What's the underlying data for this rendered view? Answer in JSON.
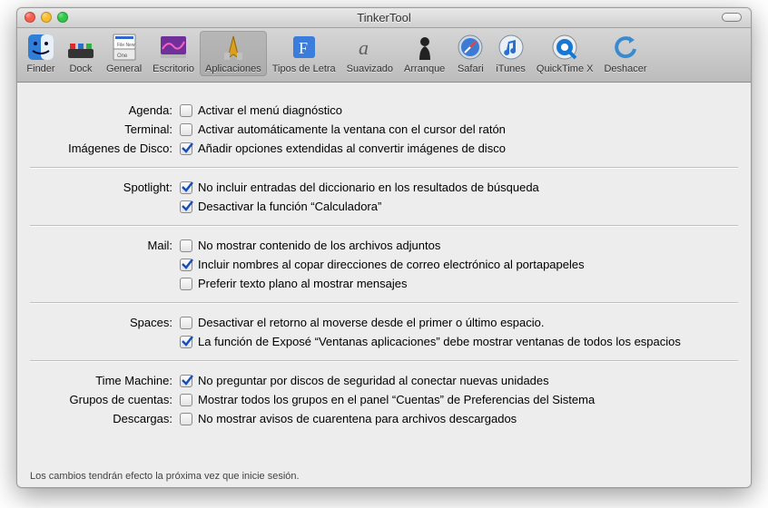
{
  "window": {
    "title": "TinkerTool"
  },
  "toolbar": {
    "items": [
      {
        "id": "finder",
        "label": "Finder"
      },
      {
        "id": "dock",
        "label": "Dock"
      },
      {
        "id": "general",
        "label": "General"
      },
      {
        "id": "escritorio",
        "label": "Escritorio"
      },
      {
        "id": "aplicaciones",
        "label": "Aplicaciones"
      },
      {
        "id": "tipos-de-letra",
        "label": "Tipos de Letra"
      },
      {
        "id": "suavizado",
        "label": "Suavizado"
      },
      {
        "id": "arranque",
        "label": "Arranque"
      },
      {
        "id": "safari",
        "label": "Safari"
      },
      {
        "id": "itunes",
        "label": "iTunes"
      },
      {
        "id": "quicktime-x",
        "label": "QuickTime X"
      },
      {
        "id": "deshacer",
        "label": "Deshacer"
      }
    ],
    "selected": "aplicaciones"
  },
  "sections": {
    "agenda": {
      "label": "Agenda:",
      "items": [
        {
          "text": "Activar el menú diagnóstico",
          "checked": false
        }
      ]
    },
    "terminal": {
      "label": "Terminal:",
      "items": [
        {
          "text": "Activar automáticamente la ventana con el cursor del ratón",
          "checked": false
        }
      ]
    },
    "imagenes": {
      "label": "Imágenes de Disco:",
      "items": [
        {
          "text": "Añadir opciones extendidas al convertir imágenes de disco",
          "checked": true
        }
      ]
    },
    "spotlight": {
      "label": "Spotlight:",
      "items": [
        {
          "text": "No incluir entradas del diccionario en los resultados de búsqueda",
          "checked": true
        },
        {
          "text": "Desactivar la función “Calculadora”",
          "checked": true
        }
      ]
    },
    "mail": {
      "label": "Mail:",
      "items": [
        {
          "text": "No mostrar contenido de los archivos adjuntos",
          "checked": false
        },
        {
          "text": "Incluir nombres al copar direcciones de correo electrónico al portapapeles",
          "checked": true
        },
        {
          "text": "Preferir texto plano al mostrar mensajes",
          "checked": false
        }
      ]
    },
    "spaces": {
      "label": "Spaces:",
      "items": [
        {
          "text": "Desactivar el retorno al moverse desde el primer o último espacio.",
          "checked": false
        },
        {
          "text": "La función de Exposé “Ventanas aplicaciones” debe mostrar ventanas de todos los espacios",
          "checked": true
        }
      ]
    },
    "timemachine": {
      "label": "Time Machine:",
      "items": [
        {
          "text": "No preguntar por discos de seguridad al conectar nuevas unidades",
          "checked": true
        }
      ]
    },
    "grupos": {
      "label": "Grupos de cuentas:",
      "items": [
        {
          "text": "Mostrar todos los grupos en el panel “Cuentas” de Preferencias del Sistema",
          "checked": false
        }
      ]
    },
    "descargas": {
      "label": "Descargas:",
      "items": [
        {
          "text": "No mostrar avisos de cuarentena para archivos descargados",
          "checked": false
        }
      ]
    }
  },
  "footer": "Los cambios tendrán efecto la próxima vez que inicie sesión."
}
